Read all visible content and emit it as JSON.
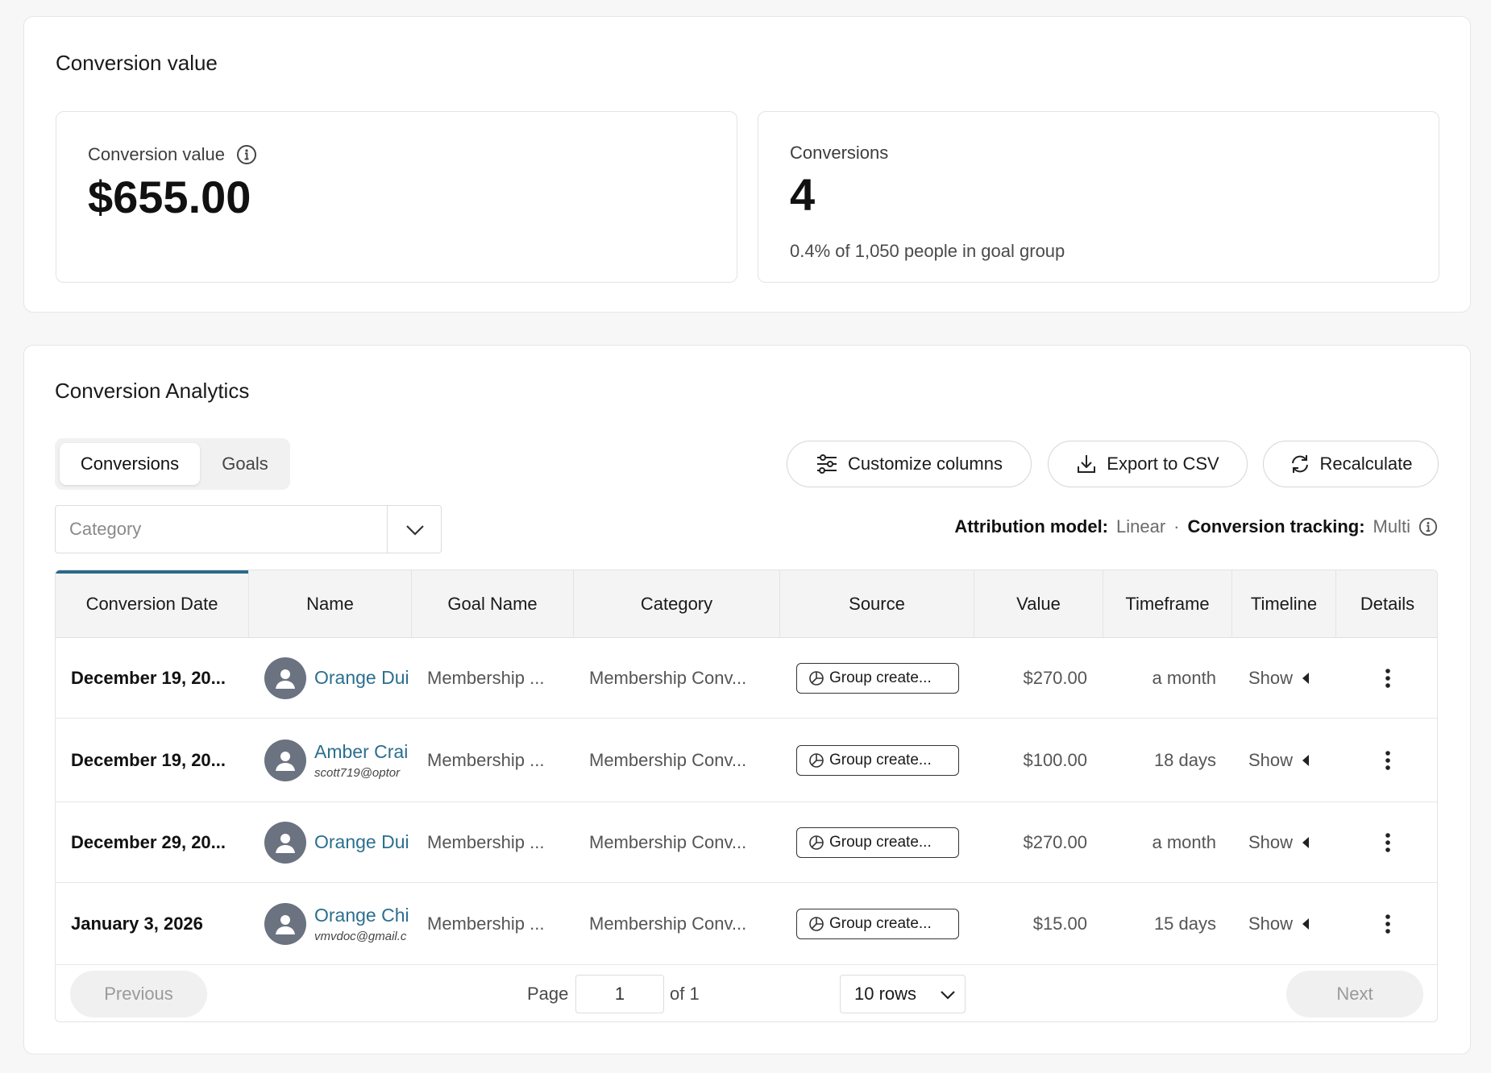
{
  "summary": {
    "title": "Conversion value",
    "value_card": {
      "label": "Conversion value",
      "value": "$655.00"
    },
    "conversions_card": {
      "label": "Conversions",
      "value": "4",
      "subtext": "0.4% of 1,050 people in goal group"
    }
  },
  "analytics": {
    "title": "Conversion Analytics",
    "tabs": [
      {
        "label": "Conversions",
        "active": true
      },
      {
        "label": "Goals",
        "active": false
      }
    ],
    "actions": {
      "customize_label": "Customize columns",
      "export_label": "Export to CSV",
      "recalculate_label": "Recalculate"
    },
    "filter": {
      "placeholder": "Category"
    },
    "attribution": {
      "model_label": "Attribution model:",
      "model_value": "Linear",
      "separator": "·",
      "tracking_label": "Conversion tracking:",
      "tracking_value": "Multi"
    },
    "columns": [
      "Conversion Date",
      "Name",
      "Goal Name",
      "Category",
      "Source",
      "Value",
      "Timeframe",
      "Timeline",
      "Details"
    ],
    "rows": [
      {
        "date": "December 19, 20...",
        "name": "Orange Dui",
        "email": "",
        "goal": "Membership ...",
        "category": "Membership Conv...",
        "source": "Group create...",
        "value": "$270.00",
        "timeframe": "a month",
        "timeline": "Show"
      },
      {
        "date": "December 19, 20...",
        "name": "Amber Crai",
        "email": "scott719@optor",
        "goal": "Membership ...",
        "category": "Membership Conv...",
        "source": "Group create...",
        "value": "$100.00",
        "timeframe": "18 days",
        "timeline": "Show"
      },
      {
        "date": "December 29, 20...",
        "name": "Orange Dui",
        "email": "",
        "goal": "Membership ...",
        "category": "Membership Conv...",
        "source": "Group create...",
        "value": "$270.00",
        "timeframe": "a month",
        "timeline": "Show"
      },
      {
        "date": "January 3, 2026",
        "name": "Orange Chi",
        "email": "vmvdoc@gmail.c",
        "goal": "Membership ...",
        "category": "Membership Conv...",
        "source": "Group create...",
        "value": "$15.00",
        "timeframe": "15 days",
        "timeline": "Show"
      }
    ],
    "pagination": {
      "previous_label": "Previous",
      "next_label": "Next",
      "page_label": "Page",
      "page_value": "1",
      "of_label": "of 1",
      "rows_label": "10 rows"
    }
  },
  "colors": {
    "link": "#2b6f8f",
    "sort_indicator": "#2c6a8a",
    "avatar": "#6b7280"
  }
}
